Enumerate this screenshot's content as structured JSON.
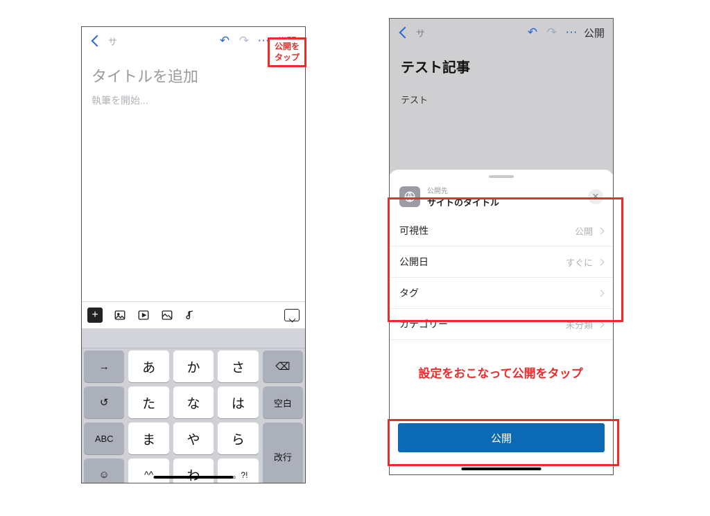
{
  "left": {
    "toolbar": {
      "back_hint": "サ",
      "undo": "↶",
      "redo": "↷",
      "more": "⋯",
      "publish": "公開"
    },
    "title_placeholder": "タイトルを追加",
    "body_placeholder": "執筆を開始...",
    "fmt": {
      "plus": "+"
    },
    "keyboard": {
      "row1": [
        "→",
        "あ",
        "か",
        "さ",
        "⌫"
      ],
      "row2": [
        "↺",
        "た",
        "な",
        "は",
        "空白"
      ],
      "row3": [
        "ABC",
        "ま",
        "や",
        "ら"
      ],
      "row4": [
        "☺",
        "^^",
        "わ",
        "、。?!"
      ],
      "newline": "改行"
    }
  },
  "right": {
    "toolbar": {
      "back_hint": "サ",
      "undo": "↶",
      "redo": "↷",
      "more": "⋯",
      "publish": "公開"
    },
    "post_title": "テスト記事",
    "post_body": "テスト",
    "sheet": {
      "dest_label": "公開先",
      "dest_value": "サイトのタイトル",
      "rows": [
        {
          "label": "可視性",
          "value": "公開"
        },
        {
          "label": "公開日",
          "value": "すぐに"
        },
        {
          "label": "タグ",
          "value": ""
        },
        {
          "label": "カテゴリー",
          "value": "未分類"
        }
      ],
      "button": "公開"
    }
  },
  "annotations": {
    "callout_line1": "公開を",
    "callout_line2": "タップ",
    "instruction": "設定をおこなって公開をタップ"
  }
}
